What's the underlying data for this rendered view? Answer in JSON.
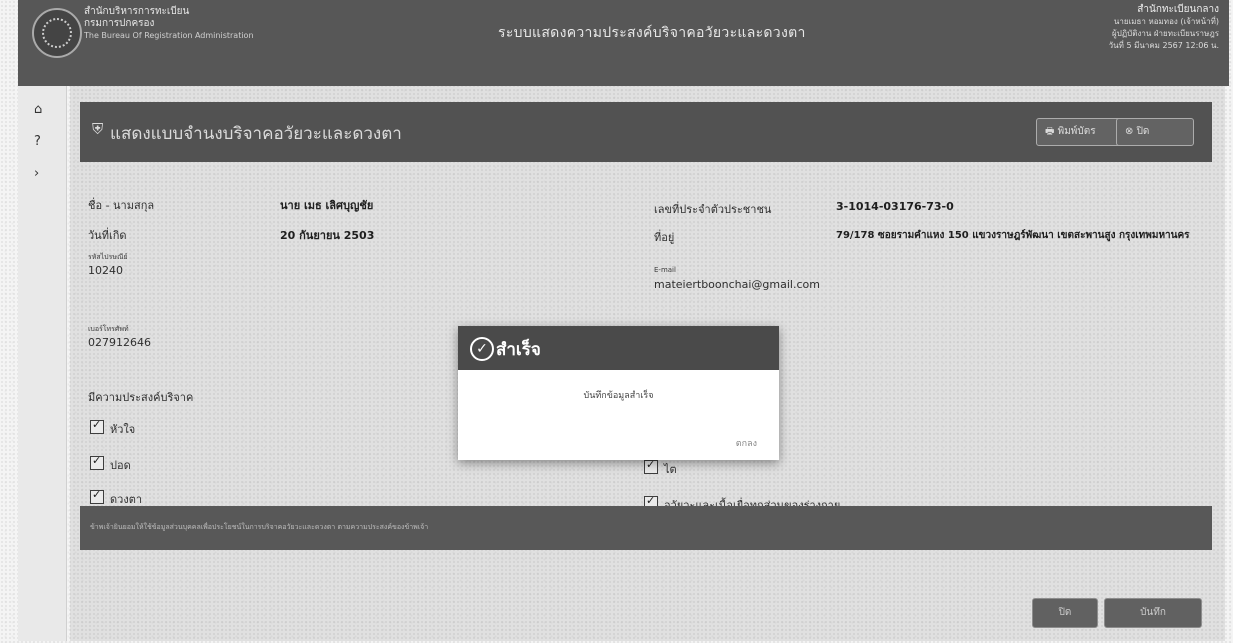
{
  "header": {
    "org_line1": "สำนักบริหารการทะเบียน",
    "org_line2": "กรมการปกครอง",
    "org_line3": "The Bureau Of Registration Administration",
    "system_title": "ระบบแสดงความประสงค์บริจาคอวัยวะและดวงตา",
    "user_line1": "สำนักทะเบียนกลาง",
    "user_line2": "นายเมธา หอมทอง (เจ้าหน้าที่)",
    "user_line3": "ผู้ปฏิบัติงาน ฝ่ายทะเบียนราษฎร",
    "user_line4": "วันที่ 5 มีนาคม 2567 12:06 น."
  },
  "sidebar": {
    "home_icon": "home-icon",
    "help_icon": "question-icon",
    "expand_icon": "chevron-right-icon"
  },
  "card": {
    "title": "แสดงแบบจำนงบริจาคอวัยวะและดวงตา",
    "print_label": "พิมพ์บัตร",
    "close_label": "ปิด"
  },
  "person": {
    "name_label": "ชื่อ - นามสกุล",
    "name_value": "นาย เมธ เลิศบุญชัย",
    "birth_label": "วันที่เกิด",
    "birth_value": "20 กันยายน 2503",
    "postcode_label": "รหัสไปรษณีย์",
    "postcode_value": "10240",
    "phone_label": "เบอร์โทรศัพท์",
    "phone_value": "027912646",
    "idcard_label": "เลขที่ประจำตัวประชาชน",
    "idcard_value": "3-1014-03176-73-0",
    "address_label": "ที่อยู่",
    "address_value": "79/178 ซอยรามคำแหง 150 แขวงราษฎร์พัฒนา เขตสะพานสูง กรุงเทพมหานคร",
    "email_label": "E-mail",
    "email_value": "mateiertboonchai@gmail.com"
  },
  "donation": {
    "heading": "มีความประสงค์บริจาค",
    "items_left": [
      "หัวใจ",
      "ปอด",
      "ดวงตา"
    ],
    "items_right": [
      "ไต",
      "อวัยวะและเนื้อเยื่อทุกส่วนของร่างกาย"
    ]
  },
  "footer_note": "ข้าพเจ้ายินยอมให้ใช้ข้อมูลส่วนบุคคลเพื่อประโยชน์ในการบริจาคอวัยวะและดวงตา ตามความประสงค์ของข้าพเจ้า",
  "bottom_buttons": [
    "ปิด",
    "บันทึก"
  ],
  "modal": {
    "title": "สำเร็จ",
    "message": "บันทึกข้อมูลสำเร็จ",
    "ok_label": "ตกลง"
  }
}
